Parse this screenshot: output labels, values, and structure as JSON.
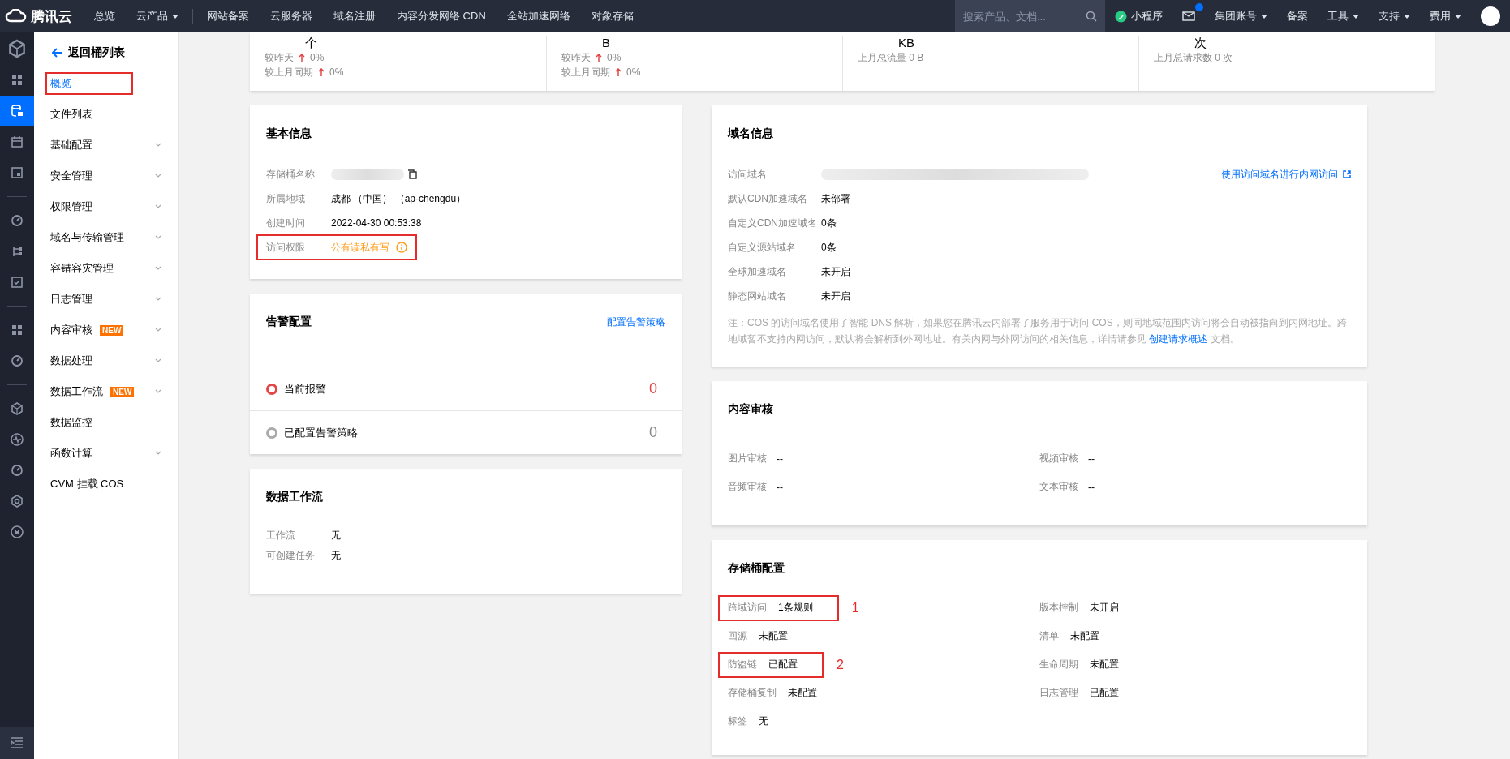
{
  "topbar": {
    "logo": "腾讯云",
    "nav": [
      {
        "label": "总览",
        "dropdown": false
      },
      {
        "label": "云产品",
        "dropdown": true
      }
    ],
    "links": [
      "网站备案",
      "云服务器",
      "域名注册",
      "内容分发网络 CDN",
      "全站加速网络",
      "对象存储"
    ],
    "search": {
      "placeholder": "搜索产品、文档..."
    },
    "right": [
      {
        "kind": "mini",
        "label": "小程序",
        "dropdown": false
      },
      {
        "kind": "mail"
      },
      {
        "kind": "text",
        "label": "集团账号",
        "dropdown": true
      },
      {
        "kind": "text",
        "label": "备案",
        "dropdown": false
      },
      {
        "kind": "text",
        "label": "工具",
        "dropdown": true
      },
      {
        "kind": "text",
        "label": "支持",
        "dropdown": true
      },
      {
        "kind": "text",
        "label": "费用",
        "dropdown": true
      },
      {
        "kind": "avatar"
      }
    ]
  },
  "rail": [
    {
      "selected": false
    },
    {
      "selected": true
    },
    {
      "selected": false
    },
    {
      "selected": false
    },
    {
      "selected": false
    },
    {
      "selected": false
    },
    {
      "selected": false
    },
    {
      "selected": false
    },
    {
      "selected": false
    },
    {
      "selected": false
    },
    {
      "selected": false
    },
    {
      "selected": false
    },
    {
      "selected": false
    },
    {
      "selected": false
    }
  ],
  "sidebar": {
    "back": "返回桶列表",
    "items": [
      {
        "label": "概览",
        "selected": true,
        "highlighted": true,
        "expandable": false
      },
      {
        "label": "文件列表",
        "selected": false,
        "highlighted": false,
        "expandable": false
      },
      {
        "label": "基础配置",
        "selected": false,
        "highlighted": false,
        "expandable": true
      },
      {
        "label": "安全管理",
        "selected": false,
        "highlighted": false,
        "expandable": true
      },
      {
        "label": "权限管理",
        "selected": false,
        "highlighted": false,
        "expandable": true
      },
      {
        "label": "域名与传输管理",
        "selected": false,
        "highlighted": false,
        "expandable": true
      },
      {
        "label": "容错容灾管理",
        "selected": false,
        "highlighted": false,
        "expandable": true
      },
      {
        "label": "日志管理",
        "selected": false,
        "highlighted": false,
        "expandable": true
      },
      {
        "label": "内容审核",
        "badge": "NEW",
        "selected": false,
        "highlighted": false,
        "expandable": true
      },
      {
        "label": "数据处理",
        "selected": false,
        "highlighted": false,
        "expandable": true
      },
      {
        "label": "数据工作流",
        "badge": "NEW",
        "selected": false,
        "highlighted": false,
        "expandable": true
      },
      {
        "label": "数据监控",
        "selected": false,
        "highlighted": false,
        "expandable": false
      },
      {
        "label": "函数计算",
        "selected": false,
        "highlighted": false,
        "expandable": true
      },
      {
        "label": "CVM 挂载 COS",
        "selected": false,
        "highlighted": false,
        "expandable": false
      }
    ]
  },
  "stats": [
    {
      "unit": "个",
      "lines": [
        {
          "label": "较昨天",
          "rising": true,
          "value": "0%"
        },
        {
          "label": "较上月同期",
          "rising": true,
          "value": "0%"
        }
      ]
    },
    {
      "unit": "B",
      "lines": [
        {
          "label": "较昨天",
          "rising": true,
          "value": "0%"
        },
        {
          "label": "较上月同期",
          "rising": true,
          "value": "0%"
        }
      ]
    },
    {
      "unit": "KB",
      "lines": [
        {
          "label": "上月总流量 0 B"
        }
      ]
    },
    {
      "unit": "次",
      "lines": [
        {
          "label": "上月总请求数 0 次"
        }
      ]
    }
  ],
  "basic_info": {
    "title": "基本信息",
    "rows": [
      {
        "label": "存储桶名称",
        "kind": "blurred",
        "value": "",
        "highlighted": false
      },
      {
        "label": "所属地域",
        "kind": "text",
        "value": "成都 （中国） （ap-chengdu）",
        "highlighted": false
      },
      {
        "label": "创建时间",
        "kind": "text",
        "value": "2022-04-30 00:53:38",
        "highlighted": false
      },
      {
        "label": "访问权限",
        "kind": "warning",
        "value": "公有读私有写",
        "highlighted": true
      }
    ]
  },
  "alarm": {
    "title": "告警配置",
    "link": "配置告警策略",
    "rows": [
      {
        "label": "当前报警",
        "count": "0",
        "active": true
      },
      {
        "label": "已配置告警策略",
        "count": "0",
        "active": false
      }
    ]
  },
  "workflow": {
    "title": "数据工作流",
    "rows": [
      {
        "label": "工作流",
        "value": "无"
      },
      {
        "label": "可创建任务",
        "value": "无"
      }
    ]
  },
  "domain_info": {
    "title": "域名信息",
    "link": "使用访问域名进行内网访问",
    "rows": [
      {
        "label": "访问域名",
        "kind": "blurred",
        "value": ""
      },
      {
        "label": "默认CDN加速域名",
        "kind": "text",
        "value": "未部署"
      },
      {
        "label": "自定义CDN加速域名",
        "kind": "text",
        "value": "0条"
      },
      {
        "label": "自定义源站域名",
        "kind": "text",
        "value": "0条"
      },
      {
        "label": "全球加速域名",
        "kind": "text",
        "value": "未开启"
      },
      {
        "label": "静态网站域名",
        "kind": "text",
        "value": "未开启"
      }
    ],
    "note": "注：COS 的访问域名使用了智能 DNS 解析，如果您在腾讯云内部署了服务用于访问 COS，则同地域范围内访问将会自动被指向到内网地址。跨地域暂不支持内网访问，默认将会解析到外网地址。有关内网与外网访问的相关信息，详情请参见",
    "note_link": "创建请求概述",
    "note_end": "文档。"
  },
  "content_audit": {
    "title": "内容审核",
    "rows": [
      {
        "label": "图片审核",
        "value": "--"
      },
      {
        "label": "视频审核",
        "value": "--"
      },
      {
        "label": "音频审核",
        "value": "--"
      },
      {
        "label": "文本审核",
        "value": "--"
      }
    ]
  },
  "bucket_config": {
    "title": "存储桶配置",
    "rows": [
      {
        "label": "跨域访问",
        "value": "1条规则",
        "highlighted": true,
        "annotation": "1"
      },
      {
        "label": "版本控制",
        "value": "未开启",
        "highlighted": false
      },
      {
        "label": "回源",
        "value": "未配置",
        "highlighted": false
      },
      {
        "label": "清单",
        "value": "未配置",
        "highlighted": false
      },
      {
        "label": "防盗链",
        "value": "已配置",
        "highlighted": true,
        "annotation": "2"
      },
      {
        "label": "生命周期",
        "value": "未配置",
        "highlighted": false
      },
      {
        "label": "存储桶复制",
        "value": "未配置",
        "highlighted": false
      },
      {
        "label": "日志管理",
        "value": "已配置",
        "highlighted": false
      },
      {
        "label": "标签",
        "value": "无",
        "highlighted": false
      }
    ]
  }
}
